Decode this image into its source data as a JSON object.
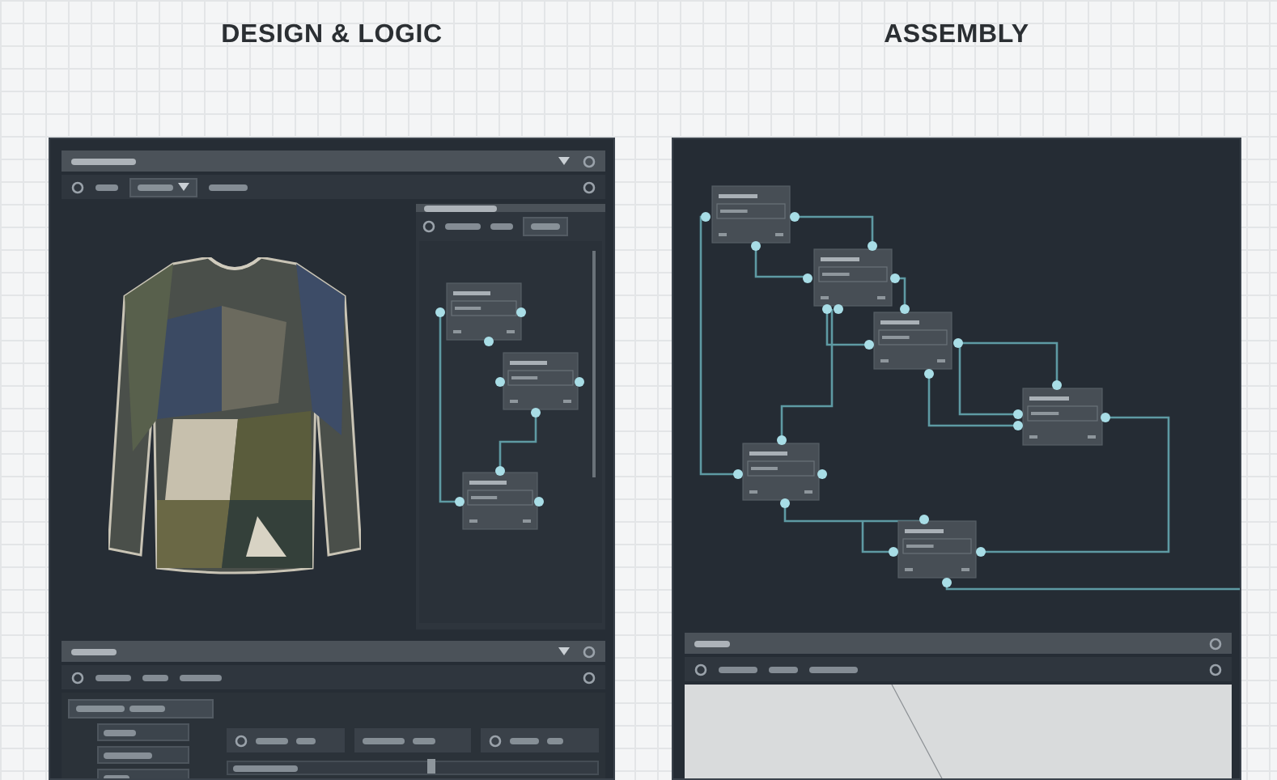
{
  "panels": [
    {
      "kind": "design",
      "heading": "DESIGN & LOGIC",
      "slider": {
        "level": 0.55
      }
    },
    {
      "kind": "assembly",
      "heading": "ASSEMBLY"
    }
  ]
}
